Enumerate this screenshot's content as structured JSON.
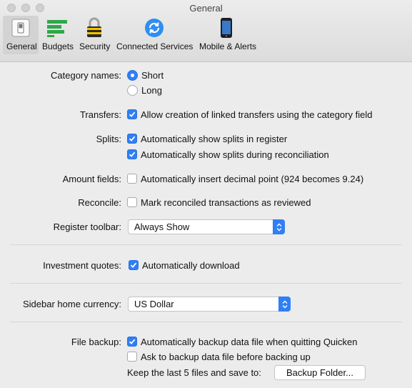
{
  "window": {
    "title": "General"
  },
  "toolbar": {
    "tabs": [
      {
        "label": "General",
        "icon": "general-switch-icon",
        "selected": true
      },
      {
        "label": "Budgets",
        "icon": "budgets-bars-icon",
        "selected": false
      },
      {
        "label": "Security",
        "icon": "lock-icon",
        "selected": false
      },
      {
        "label": "Connected Services",
        "icon": "sync-icon",
        "selected": false
      },
      {
        "label": "Mobile & Alerts",
        "icon": "phone-icon",
        "selected": false
      }
    ]
  },
  "form": {
    "category_names": {
      "label": "Category names:",
      "options": [
        {
          "label": "Short",
          "selected": true
        },
        {
          "label": "Long",
          "selected": false
        }
      ]
    },
    "transfers": {
      "label": "Transfers:",
      "option": "Allow creation of linked transfers using the category field",
      "checked": true
    },
    "splits": {
      "label": "Splits:",
      "options": [
        {
          "label": "Automatically show splits in register",
          "checked": true
        },
        {
          "label": "Automatically show splits during reconciliation",
          "checked": true
        }
      ]
    },
    "amount_fields": {
      "label": "Amount fields:",
      "option": "Automatically insert decimal point (924 becomes 9.24)",
      "checked": false
    },
    "reconcile": {
      "label": "Reconcile:",
      "option": "Mark reconciled transactions as reviewed",
      "checked": false
    },
    "register_toolbar": {
      "label": "Register toolbar:",
      "value": "Always Show"
    },
    "investment_quotes": {
      "label": "Investment quotes:",
      "option": "Automatically download",
      "checked": true
    },
    "sidebar_currency": {
      "label": "Sidebar home currency:",
      "value": "US Dollar"
    },
    "file_backup": {
      "label": "File backup:",
      "options": [
        {
          "label": "Automatically backup data file when quitting Quicken",
          "checked": true
        },
        {
          "label": "Ask to backup data file before backing up",
          "checked": false
        }
      ],
      "keep_text": "Keep the last 5 files and save to:",
      "button": "Backup Folder..."
    }
  },
  "colors": {
    "accent": "#2f7ff6",
    "background": "#ececec"
  }
}
